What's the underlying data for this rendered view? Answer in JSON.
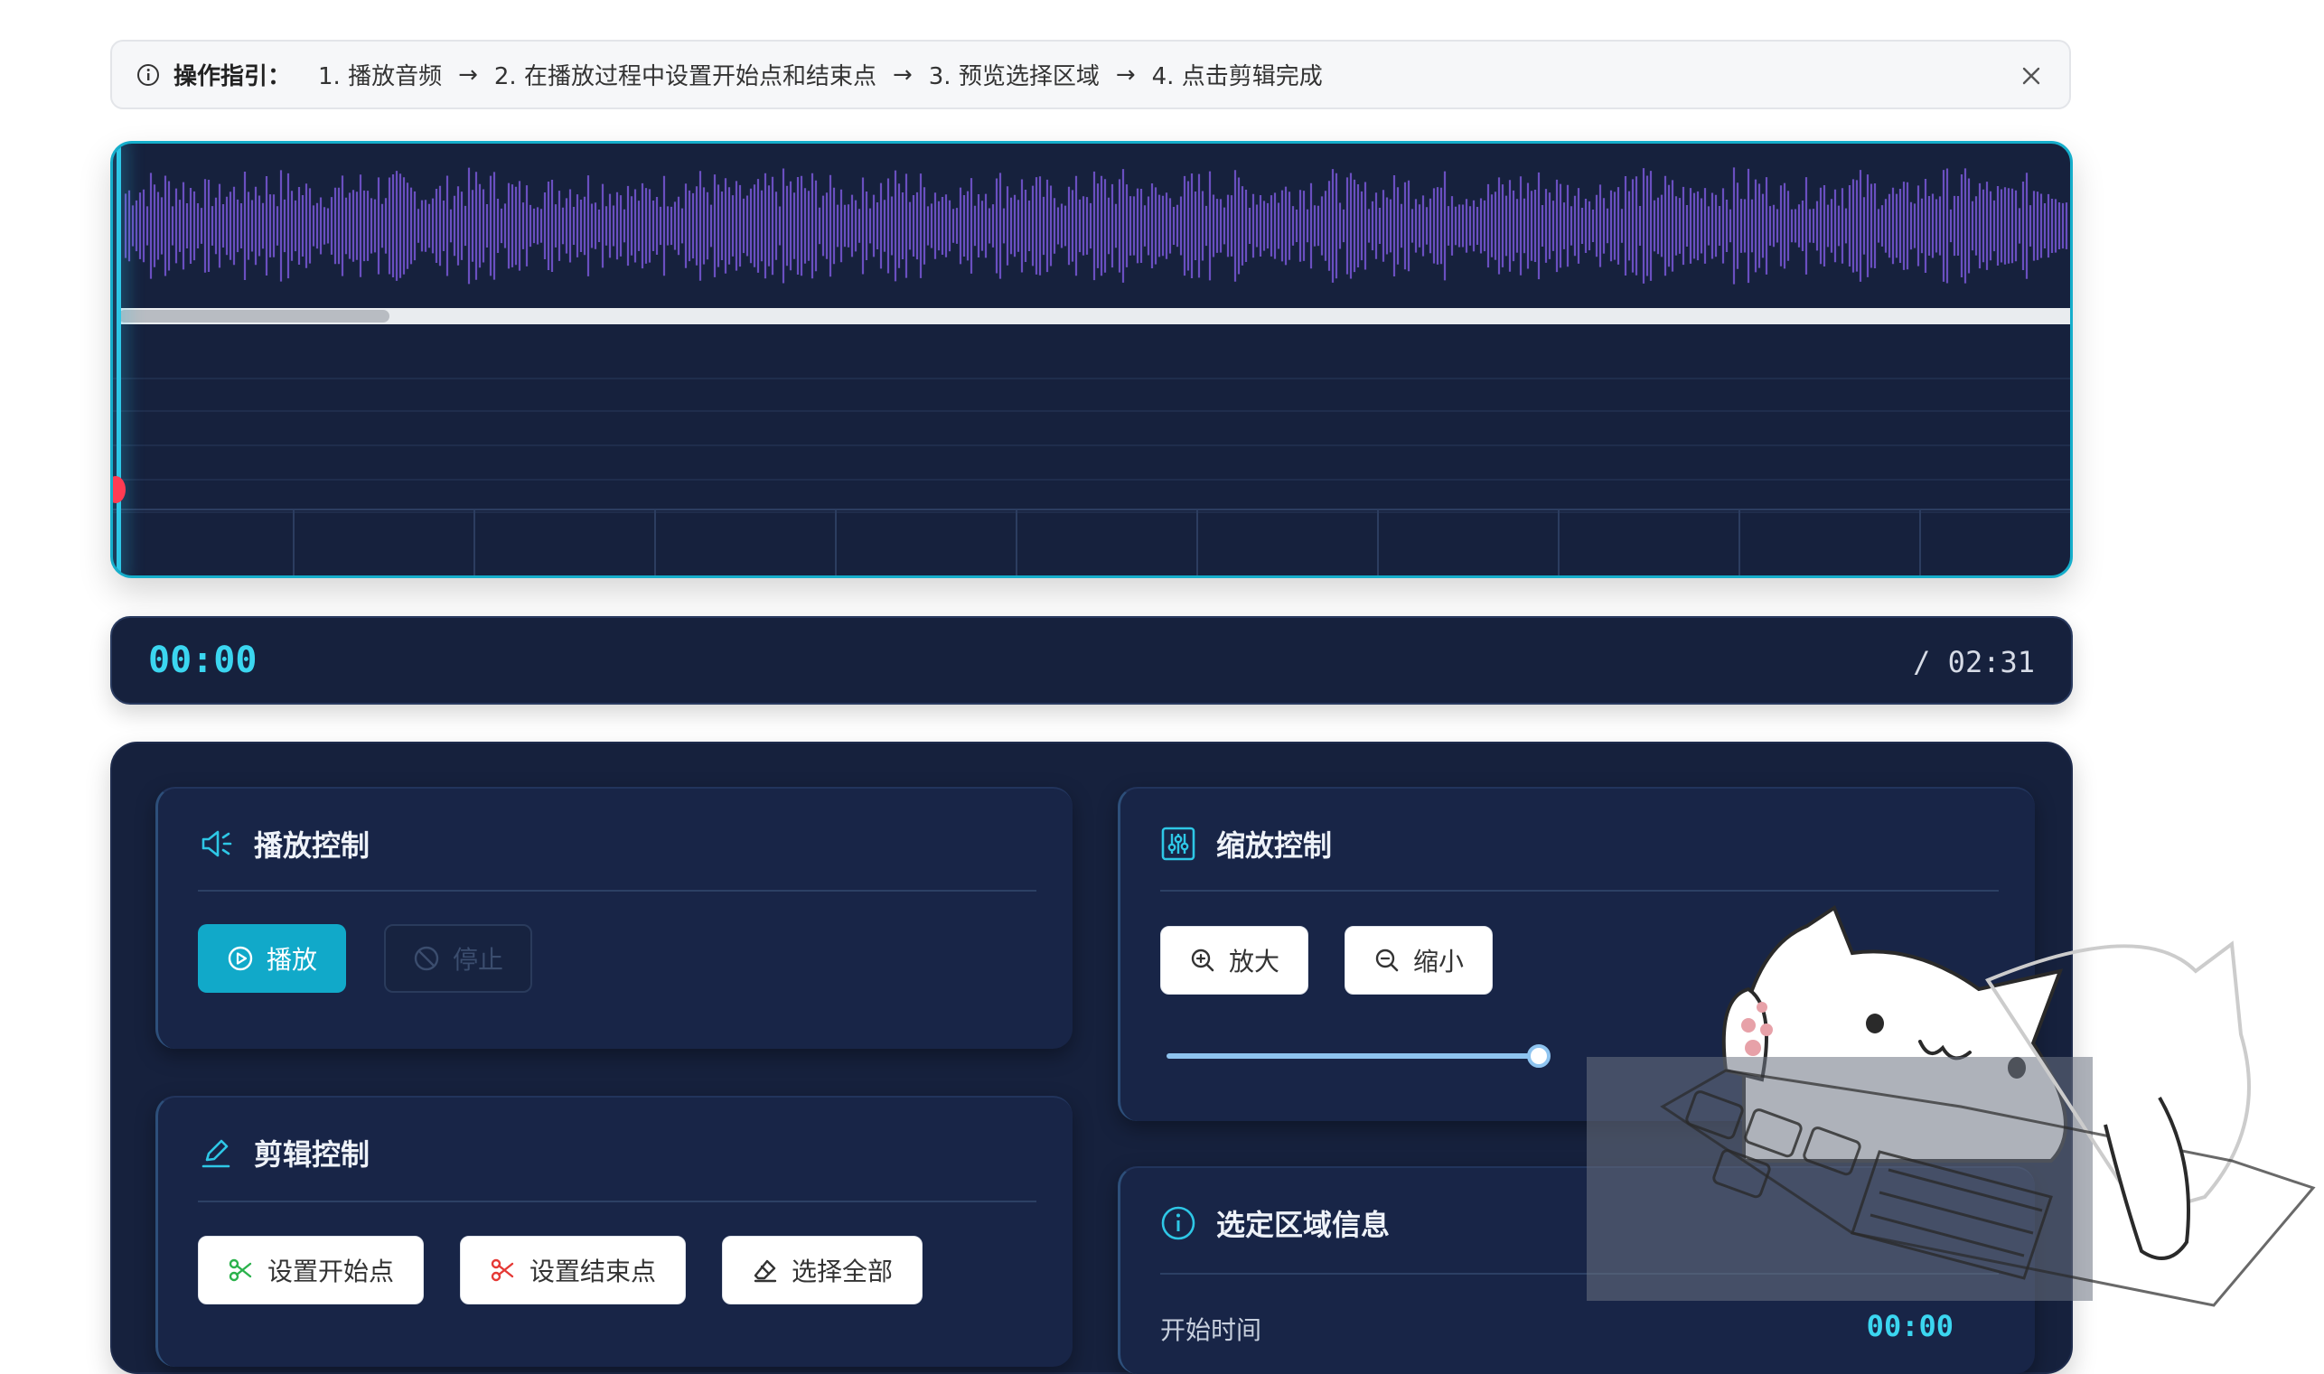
{
  "guide": {
    "title": "操作指引：",
    "steps": [
      "1. 播放音频",
      "2. 在播放过程中设置开始点和结束点",
      "3. 预览选择区域",
      "4. 点击剪辑完成"
    ],
    "arrow": "→"
  },
  "time": {
    "current": "00:00",
    "total": "/ 02:31"
  },
  "playback": {
    "title": "播放控制",
    "play_label": "播放",
    "stop_label": "停止"
  },
  "zoom": {
    "title": "缩放控制",
    "zoom_in_label": "放大",
    "zoom_out_label": "缩小",
    "level": 1.0
  },
  "edit": {
    "title": "剪辑控制",
    "set_start_label": "设置开始点",
    "set_end_label": "设置结束点",
    "select_all_label": "选择全部"
  },
  "selection": {
    "title": "选定区域信息",
    "start_label": "开始时间",
    "start_value": "00:00"
  },
  "colors": {
    "accent": "#11a9c9",
    "panel_bg": "#16213d",
    "wave": "#6a4fc0",
    "time_text": "#3bd6f0"
  },
  "icons": [
    "info-icon",
    "close-icon",
    "speaker-icon",
    "play-circle-icon",
    "stop-icon",
    "sliders-icon",
    "zoom-in-icon",
    "zoom-out-icon",
    "pen-icon",
    "scissors-icon",
    "eraser-icon",
    "info-circle-icon"
  ]
}
